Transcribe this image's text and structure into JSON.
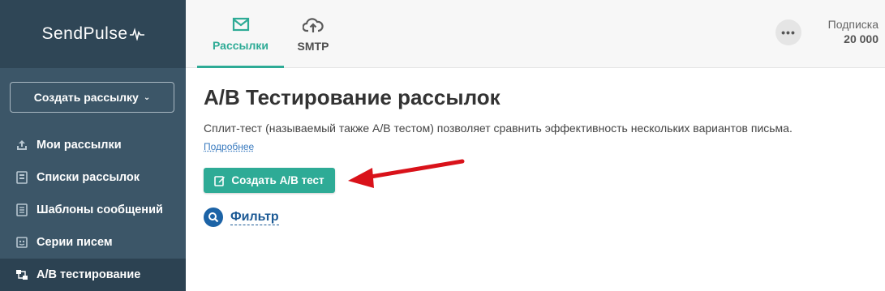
{
  "brand": {
    "name": "SendPulse"
  },
  "sidebar": {
    "create_button": "Создать рассылку",
    "items": [
      {
        "label": "Мои рассылки",
        "icon": "upload-tray-icon"
      },
      {
        "label": "Списки рассылок",
        "icon": "list-book-icon"
      },
      {
        "label": "Шаблоны сообщений",
        "icon": "template-icon"
      },
      {
        "label": "Серии писем",
        "icon": "series-icon"
      },
      {
        "label": "A/B тестирование",
        "icon": "ab-test-icon",
        "active": true
      }
    ]
  },
  "topbar": {
    "tabs": [
      {
        "label": "Рассылки",
        "icon": "envelope-icon",
        "active": true
      },
      {
        "label": "SMTP",
        "icon": "cloud-upload-icon"
      }
    ],
    "more": "•••",
    "subscription_label": "Подписка",
    "subscription_value": "20 000"
  },
  "main": {
    "title": "A/B Тестирование рассылок",
    "description": "Сплит-тест (называемый также A/B тестом) позволяет сравнить эффективность нескольких вариантов письма.",
    "more_link": "Подробнее",
    "create_ab_button": "Создать A/B тест",
    "filter_label": "Фильтр"
  },
  "colors": {
    "sidebar": "#3c5668",
    "sidebar_dark": "#2f4656",
    "accent": "#2eab96",
    "link": "#1c5a95",
    "arrow": "#d9121a"
  }
}
